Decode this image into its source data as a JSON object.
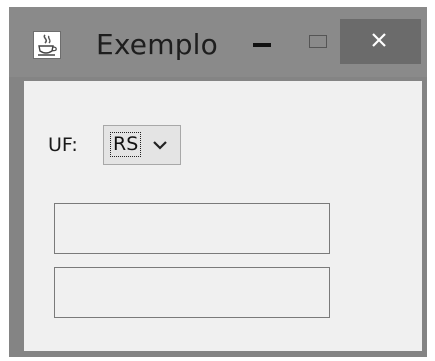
{
  "window": {
    "title": "Exemplo",
    "icon": "java-coffee-icon",
    "controls": {
      "minimize_icon": "minimize-icon",
      "maximize_icon": "maximize-icon",
      "close_icon": "close-icon"
    }
  },
  "form": {
    "uf_label": "UF:",
    "uf_selected": "RS",
    "uf_dropdown_icon": "chevron-down-icon",
    "text_field_1": {
      "value": ""
    },
    "text_field_2": {
      "value": ""
    }
  },
  "colors": {
    "title_bar": "#8a8a8a",
    "window_border": "#848484",
    "close_button": "#6b6b6b",
    "client_background": "#f0f0f0"
  }
}
